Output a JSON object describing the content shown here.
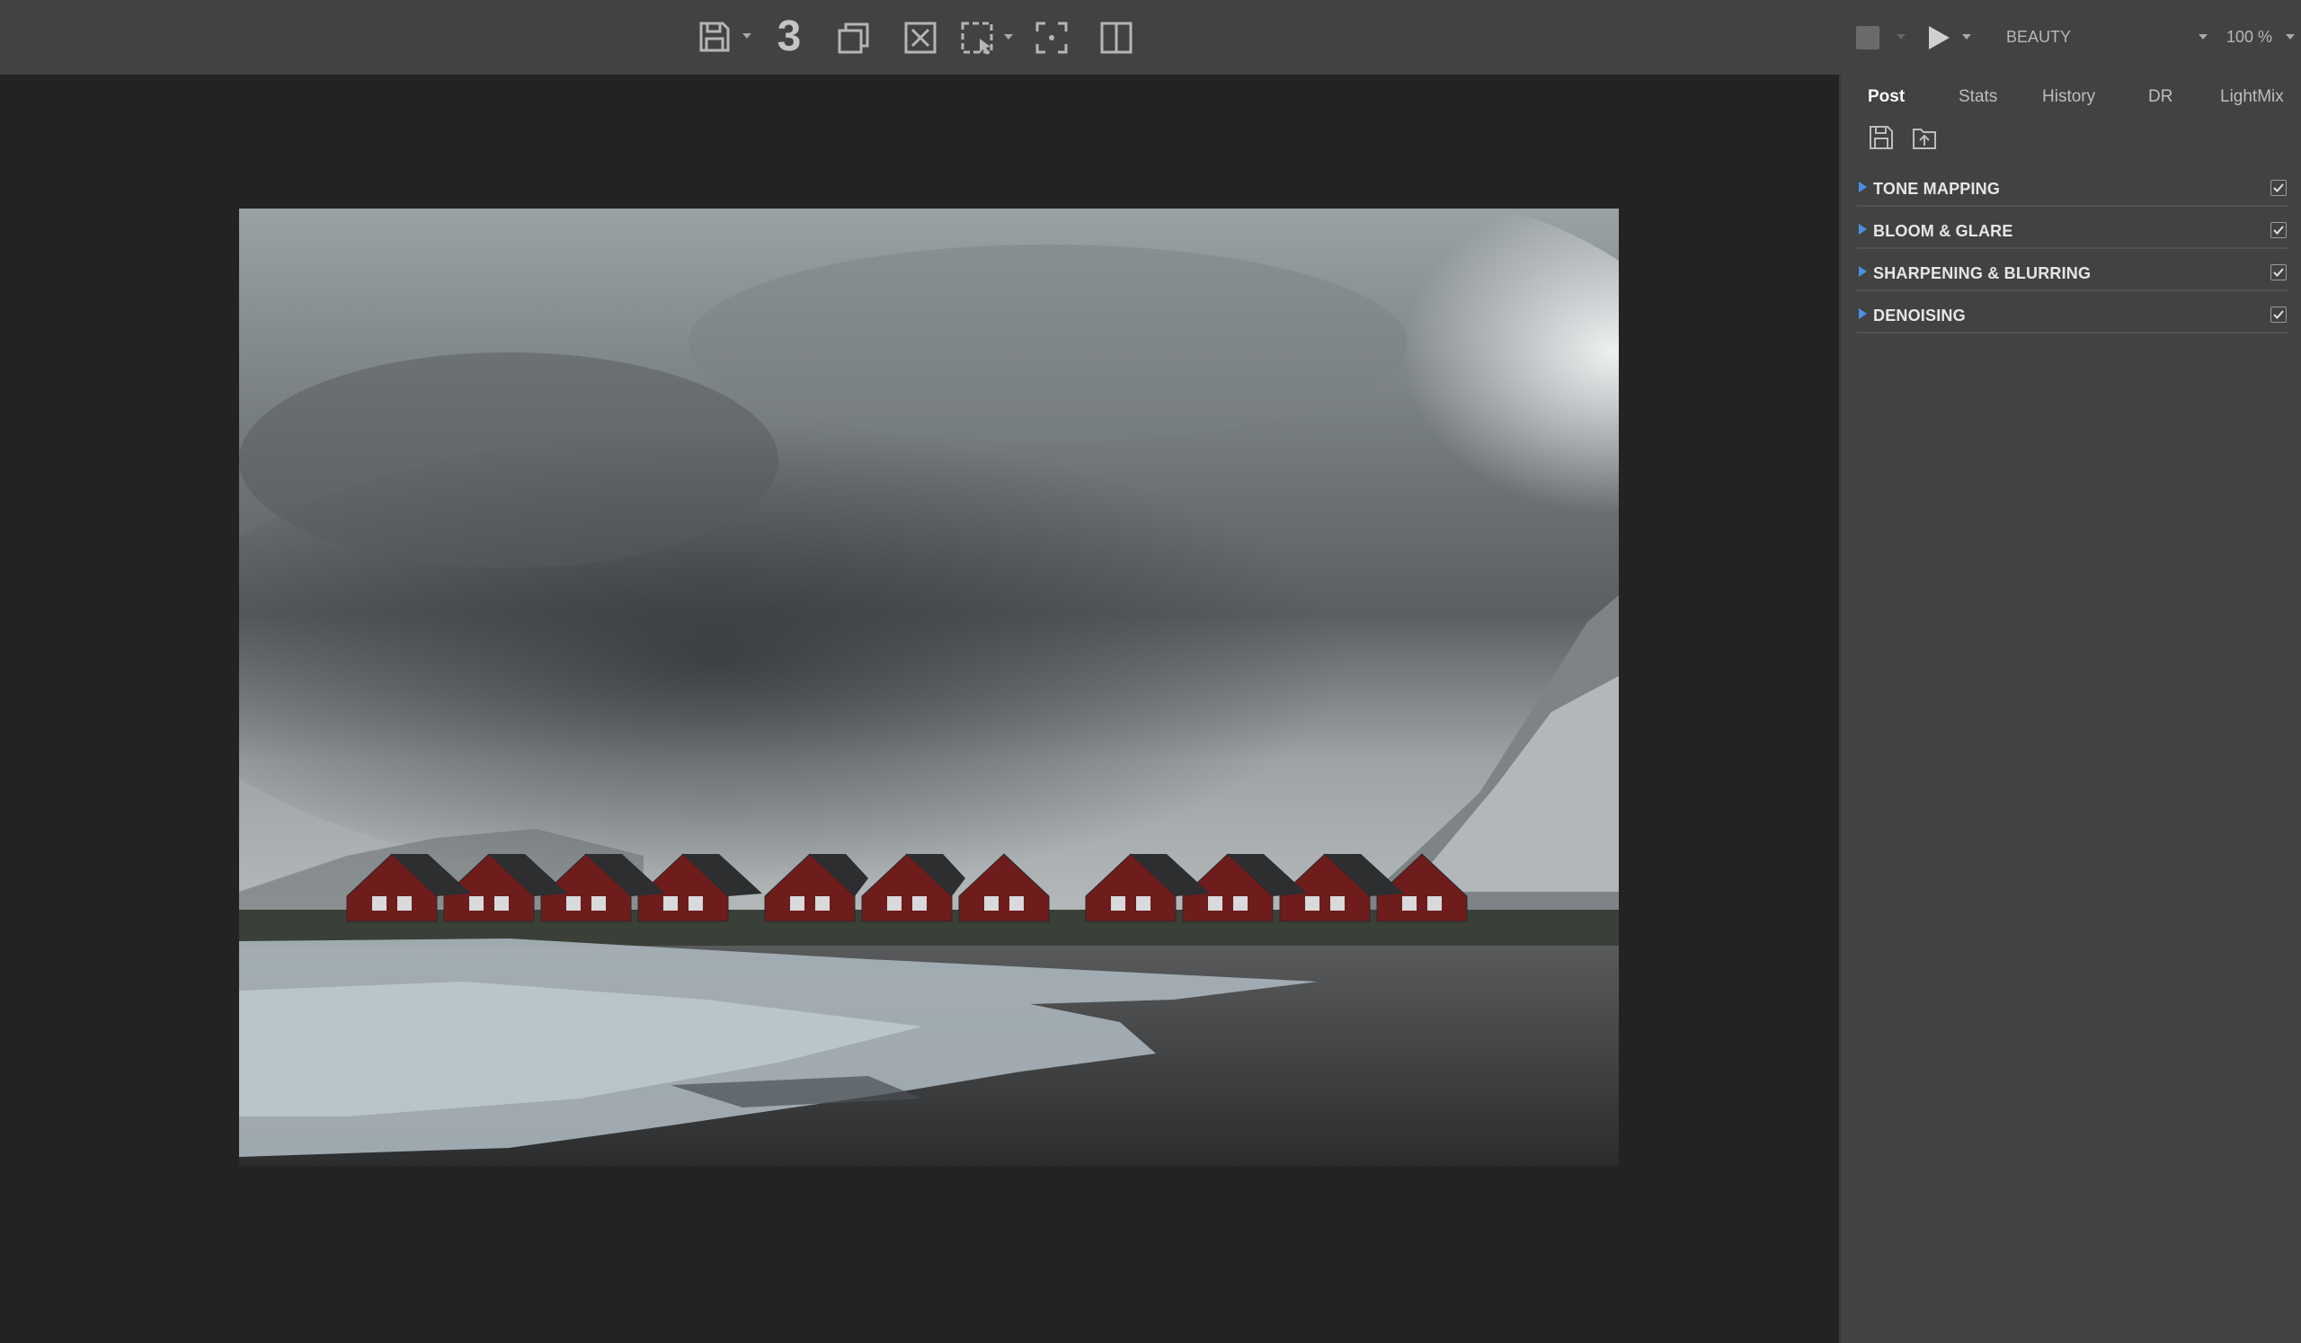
{
  "toolbar": {
    "history_count": "3",
    "icons": [
      "save-icon",
      "copy-icon",
      "clear-icon",
      "region-select-icon",
      "focus-icon",
      "split-view-icon"
    ]
  },
  "render_controls": {
    "channel": "BEAUTY",
    "zoom": "100 %"
  },
  "panel": {
    "tabs": [
      {
        "label": "Post",
        "active": true
      },
      {
        "label": "Stats",
        "active": false
      },
      {
        "label": "History",
        "active": false
      },
      {
        "label": "DR",
        "active": false
      },
      {
        "label": "LightMix",
        "active": false
      }
    ],
    "sections": [
      {
        "label": "TONE MAPPING",
        "enabled": true
      },
      {
        "label": "BLOOM & GLARE",
        "enabled": true
      },
      {
        "label": "SHARPENING & BLURRING",
        "enabled": true
      },
      {
        "label": "DENOISING",
        "enabled": true
      }
    ]
  },
  "colors": {
    "toolbar_bg": "#424242",
    "canvas_bg": "#232323",
    "accent": "#4a90e2"
  }
}
